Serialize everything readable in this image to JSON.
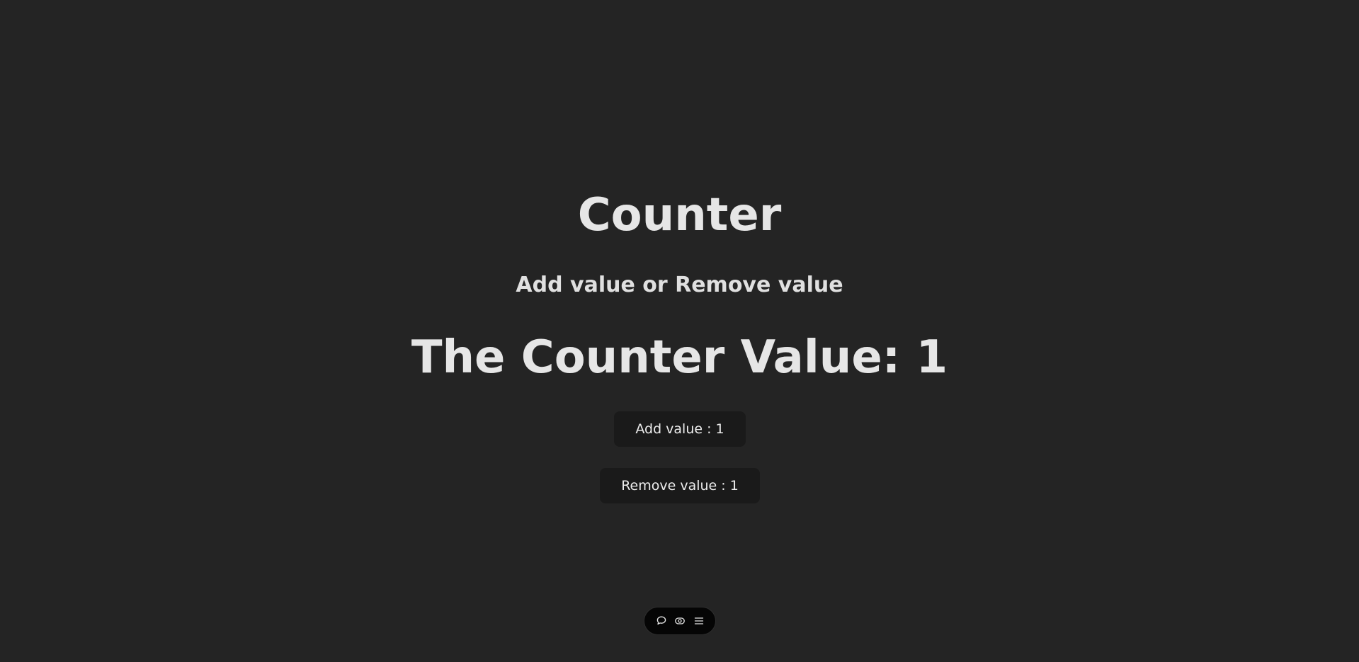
{
  "header": {
    "title": "Counter",
    "subtitle": "Add value or Remove value"
  },
  "counter": {
    "label": "The Counter Value: 1",
    "value": 1
  },
  "buttons": {
    "add_label": "Add value : 1",
    "remove_label": "Remove value : 1"
  },
  "toolbar": {
    "icons": [
      "comment-icon",
      "eye-icon",
      "menu-icon"
    ]
  },
  "colors": {
    "background": "#242424",
    "button_background": "#1a1a1a",
    "text": "#e6e6e6",
    "toolbar_background": "#050505"
  }
}
